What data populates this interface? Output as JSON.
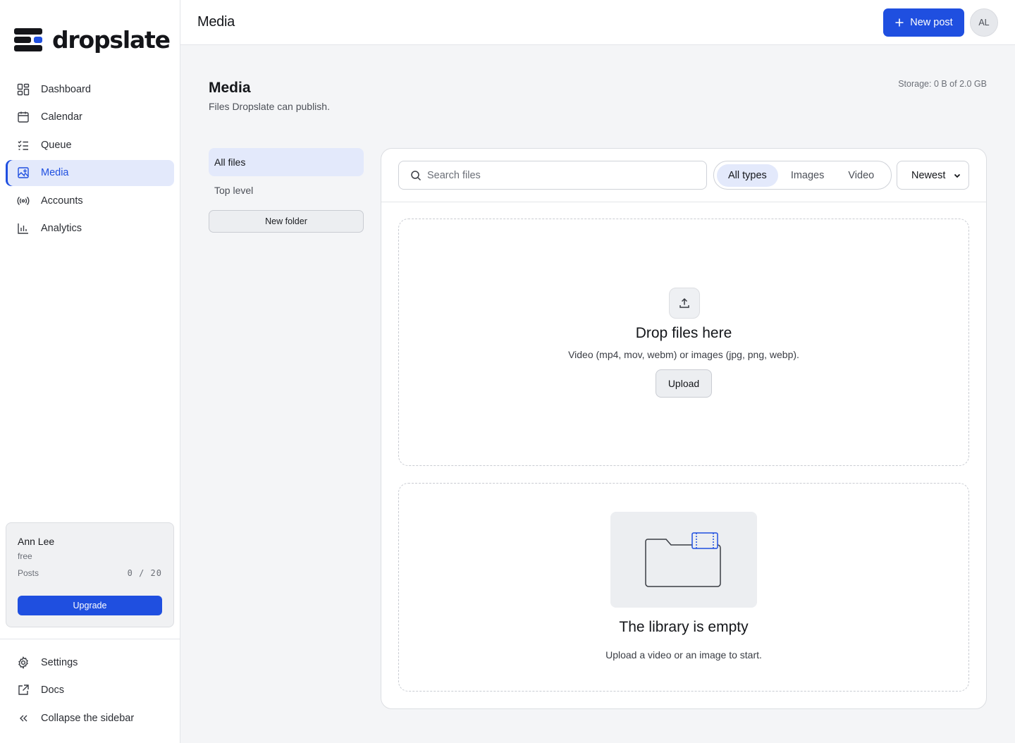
{
  "brand": {
    "name": "dropslate",
    "accent": "#1f4fe0"
  },
  "sidebar": {
    "items": [
      {
        "label": "Dashboard",
        "icon": "dashboard-grid-icon"
      },
      {
        "label": "Calendar",
        "icon": "calendar-icon"
      },
      {
        "label": "Queue",
        "icon": "checklist-icon"
      },
      {
        "label": "Media",
        "icon": "image-icon",
        "active": true
      },
      {
        "label": "Accounts",
        "icon": "broadcast-icon"
      },
      {
        "label": "Analytics",
        "icon": "bar-chart-icon"
      }
    ],
    "plan": {
      "user": "Ann Lee",
      "tier": "free",
      "posts_label": "Posts",
      "posts_value": "0 / 20",
      "upgrade_label": "Upgrade"
    },
    "bottom_items": [
      {
        "label": "Settings",
        "icon": "gear-icon"
      },
      {
        "label": "Docs",
        "icon": "external-link-icon"
      },
      {
        "label": "Collapse the sidebar",
        "icon": "double-chevron-left-icon"
      }
    ]
  },
  "header": {
    "title": "Media",
    "new_post_label": "New post",
    "avatar_initials": "AL"
  },
  "page": {
    "title": "Media",
    "subtitle": "Files Dropslate can publish.",
    "storage": "Storage: 0 B of 2.0 GB"
  },
  "folders": {
    "items": [
      {
        "label": "All files",
        "active": true
      },
      {
        "label": "Top level",
        "active": false
      }
    ],
    "new_folder_label": "New folder"
  },
  "toolbar": {
    "search_placeholder": "Search files",
    "filters": [
      {
        "label": "All types",
        "active": true
      },
      {
        "label": "Images",
        "active": false
      },
      {
        "label": "Video",
        "active": false
      }
    ],
    "sort_selected": "Newest"
  },
  "dropzone": {
    "title": "Drop files here",
    "hint": "Video (mp4, mov, webm) or images (jpg, png, webp).",
    "upload_label": "Upload"
  },
  "empty": {
    "title": "The library is empty",
    "hint": "Upload a video or an image to start."
  }
}
